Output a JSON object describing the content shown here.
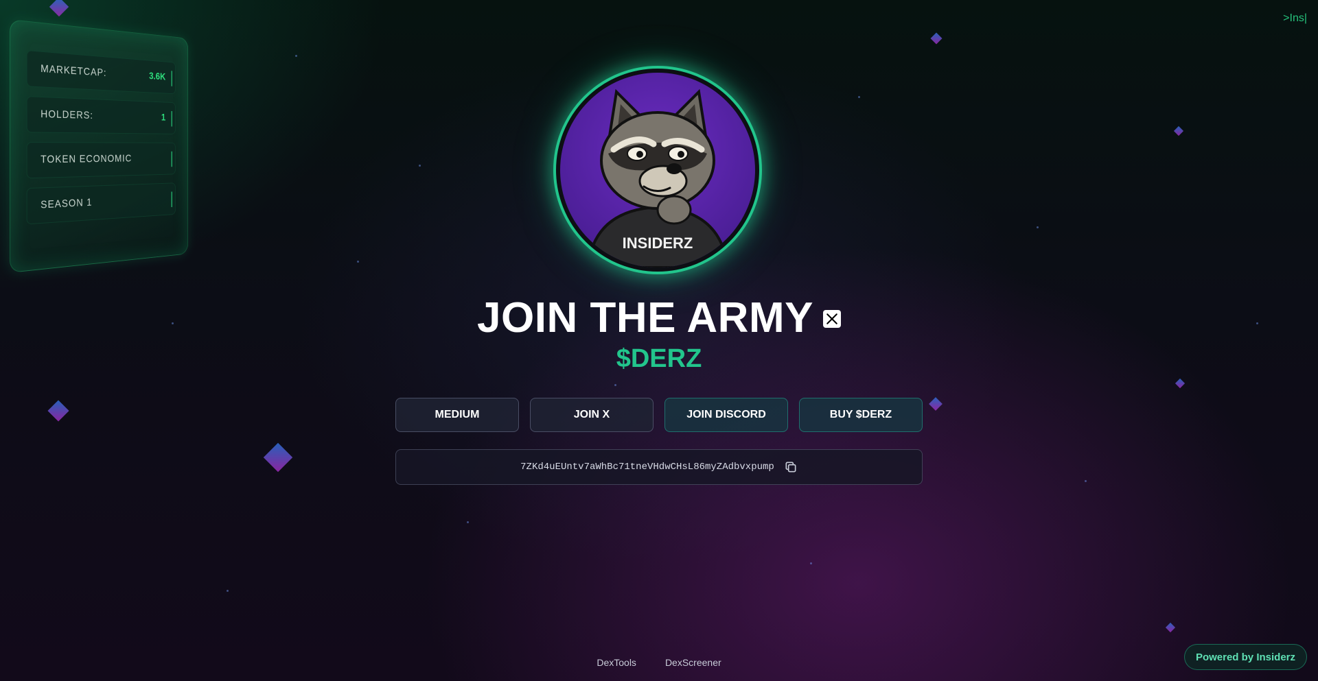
{
  "corner": {
    "text": ">Ins|"
  },
  "stats": [
    {
      "label": "MARKETCAP:",
      "value": "3.6K"
    },
    {
      "label": "HOLDERS:",
      "value": "1"
    },
    {
      "label": "TOKEN ECONOMIC",
      "value": ""
    },
    {
      "label": "SEASON 1",
      "value": ""
    }
  ],
  "avatar": {
    "shirt_text": "INSIDERZ"
  },
  "hero": {
    "title": "JOIN THE ARMY",
    "ticker": "$DERZ"
  },
  "buttons": {
    "medium": "MEDIUM",
    "join_x": "JOIN X",
    "join_discord": "JOIN DISCORD",
    "buy": "BUY $DERZ"
  },
  "contract": {
    "address": "7ZKd4uEUntv7aWhBc71tneVHdwCHsL86myZAdbvxpump"
  },
  "footer": {
    "dextools": "DexTools",
    "dexscreener": "DexScreener"
  },
  "powered": {
    "label": "Powered by Insiderz"
  },
  "colors": {
    "accent": "#22c58c",
    "stat_value": "#2ee07e",
    "background": "#0b0b12"
  },
  "icons": [
    "x-logo-icon",
    "copy-icon"
  ]
}
